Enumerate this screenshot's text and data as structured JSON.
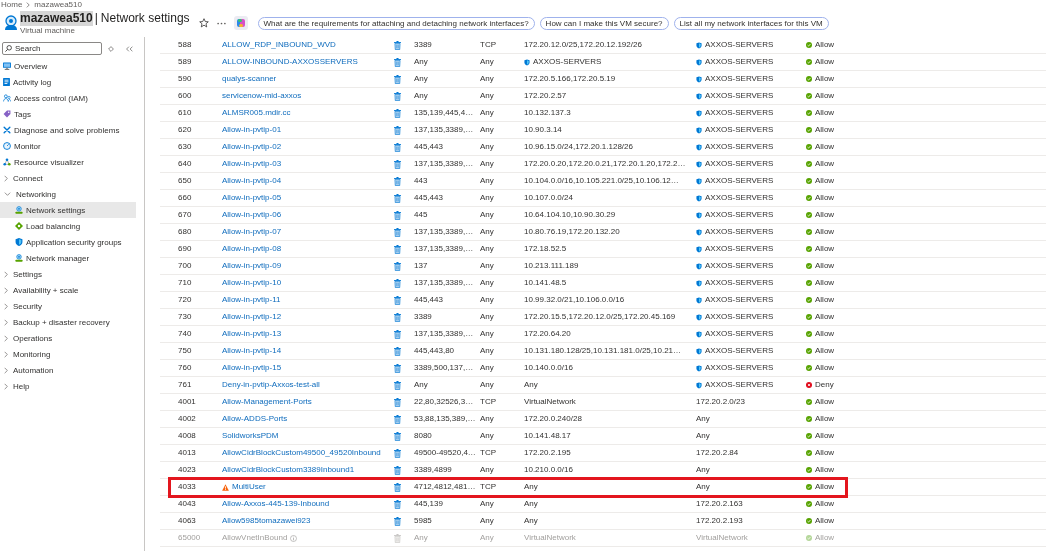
{
  "breadcrumb": [
    {
      "label": "Home"
    },
    {
      "label": "mazawea510"
    }
  ],
  "header": {
    "title": {
      "name": "mazawea510",
      "highlighted": true,
      "separator": "|",
      "page": "Network settings"
    },
    "subtitle": "Virtual machine",
    "suggestions": [
      {
        "label": "What are the requirements for attaching and detaching network interfaces?"
      },
      {
        "label": "How can I make this VM secure?"
      },
      {
        "label": "List all my network interfaces for this VM"
      }
    ]
  },
  "sidebar": {
    "search": {
      "placeholder": "Search"
    },
    "items": [
      {
        "kind": "link",
        "label": "Overview",
        "selected": false
      },
      {
        "kind": "link",
        "label": "Activity log",
        "selected": false
      },
      {
        "kind": "link",
        "label": "Access control (IAM)",
        "selected": false
      },
      {
        "kind": "link",
        "label": "Tags",
        "selected": false
      },
      {
        "kind": "link",
        "label": "Diagnose and solve problems",
        "selected": false
      },
      {
        "kind": "link",
        "label": "Monitor",
        "selected": false
      },
      {
        "kind": "link",
        "label": "Resource visualizer",
        "selected": false
      },
      {
        "kind": "group",
        "label": "Connect",
        "selected": false,
        "expanded": false
      },
      {
        "kind": "group",
        "label": "Networking",
        "selected": false,
        "expanded": true,
        "children": [
          {
            "kind": "link",
            "label": "Network settings",
            "selected": true
          },
          {
            "kind": "link",
            "label": "Load balancing",
            "selected": false
          },
          {
            "kind": "link",
            "label": "Application security groups",
            "selected": false
          },
          {
            "kind": "link",
            "label": "Network manager",
            "selected": false
          }
        ]
      },
      {
        "kind": "group",
        "label": "Settings",
        "selected": false,
        "expanded": false
      },
      {
        "kind": "group",
        "label": "Availability + scale",
        "selected": false,
        "expanded": false
      },
      {
        "kind": "group",
        "label": "Security",
        "selected": false,
        "expanded": false
      },
      {
        "kind": "group",
        "label": "Backup + disaster recovery",
        "selected": false,
        "expanded": false
      },
      {
        "kind": "group",
        "label": "Operations",
        "selected": false,
        "expanded": false
      },
      {
        "kind": "group",
        "label": "Monitoring",
        "selected": false,
        "expanded": false
      },
      {
        "kind": "group",
        "label": "Automation",
        "selected": false,
        "expanded": false
      },
      {
        "kind": "group",
        "label": "Help",
        "selected": false,
        "expanded": false
      }
    ]
  },
  "table": {
    "rows": [
      {
        "kind": "custom",
        "highlighted": false,
        "column_1": "588",
        "column_2": "ALLOW_RDP_INBOUND_WVD",
        "column_3": "3389",
        "column_4": "TCP",
        "column_5": {
          "kind": "address",
          "text": "172.20.12.0/25,172.20.12.192/26"
        },
        "column_6": {
          "kind": "group",
          "text": "AXXOS-SERVERS"
        },
        "column_7": {
          "kind": "allow",
          "text": "Allow"
        }
      },
      {
        "kind": "custom",
        "highlighted": false,
        "column_1": "589",
        "column_2": "ALLOW-INBOUND-AXXOSSERVERS",
        "column_3": "Any",
        "column_4": "Any",
        "column_5": {
          "kind": "group",
          "text": "AXXOS-SERVERS"
        },
        "column_6": {
          "kind": "group",
          "text": "AXXOS-SERVERS"
        },
        "column_7": {
          "kind": "allow",
          "text": "Allow"
        }
      },
      {
        "kind": "custom",
        "highlighted": false,
        "column_1": "590",
        "column_2": "qualys-scanner",
        "column_3": "Any",
        "column_4": "Any",
        "column_5": {
          "kind": "address",
          "text": "172.20.5.166,172.20.5.19"
        },
        "column_6": {
          "kind": "group",
          "text": "AXXOS-SERVERS"
        },
        "column_7": {
          "kind": "allow",
          "text": "Allow"
        }
      },
      {
        "kind": "custom",
        "highlighted": false,
        "column_1": "600",
        "column_2": "servicenow-mid-axxos",
        "column_3": "Any",
        "column_4": "Any",
        "column_5": {
          "kind": "address",
          "text": "172.20.2.57"
        },
        "column_6": {
          "kind": "group",
          "text": "AXXOS-SERVERS"
        },
        "column_7": {
          "kind": "allow",
          "text": "Allow"
        }
      },
      {
        "kind": "custom",
        "highlighted": false,
        "column_1": "610",
        "column_2": "ALMSR005.mdir.cc",
        "column_3": "135,139,445,4…",
        "column_4": "Any",
        "column_5": {
          "kind": "address",
          "text": "10.132.137.3"
        },
        "column_6": {
          "kind": "group",
          "text": "AXXOS-SERVERS"
        },
        "column_7": {
          "kind": "allow",
          "text": "Allow"
        }
      },
      {
        "kind": "custom",
        "highlighted": false,
        "column_1": "620",
        "column_2": "Allow-in-pvtip-01",
        "column_3": "137,135,3389,…",
        "column_4": "Any",
        "column_5": {
          "kind": "address",
          "text": "10.90.3.14"
        },
        "column_6": {
          "kind": "group",
          "text": "AXXOS-SERVERS"
        },
        "column_7": {
          "kind": "allow",
          "text": "Allow"
        }
      },
      {
        "kind": "custom",
        "highlighted": false,
        "column_1": "630",
        "column_2": "Allow-in-pvtip-02",
        "column_3": "445,443",
        "column_4": "Any",
        "column_5": {
          "kind": "address",
          "text": "10.96.15.0/24,172.20.1.128/26"
        },
        "column_6": {
          "kind": "group",
          "text": "AXXOS-SERVERS"
        },
        "column_7": {
          "kind": "allow",
          "text": "Allow"
        }
      },
      {
        "kind": "custom",
        "highlighted": false,
        "column_1": "640",
        "column_2": "Allow-in-pvtip-03",
        "column_3": "137,135,3389,…",
        "column_4": "Any",
        "column_5": {
          "kind": "address",
          "text": "172.20.0.20,172.20.0.21,172.20.1.20,172.2…"
        },
        "column_6": {
          "kind": "group",
          "text": "AXXOS-SERVERS"
        },
        "column_7": {
          "kind": "allow",
          "text": "Allow"
        }
      },
      {
        "kind": "custom",
        "highlighted": false,
        "column_1": "650",
        "column_2": "Allow-in-pvtip-04",
        "column_3": "443",
        "column_4": "Any",
        "column_5": {
          "kind": "address",
          "text": "10.104.0.0/16,10.105.221.0/25,10.106.12…"
        },
        "column_6": {
          "kind": "group",
          "text": "AXXOS-SERVERS"
        },
        "column_7": {
          "kind": "allow",
          "text": "Allow"
        }
      },
      {
        "kind": "custom",
        "highlighted": false,
        "column_1": "660",
        "column_2": "Allow-in-pvtip-05",
        "column_3": "445,443",
        "column_4": "Any",
        "column_5": {
          "kind": "address",
          "text": "10.107.0.0/24"
        },
        "column_6": {
          "kind": "group",
          "text": "AXXOS-SERVERS"
        },
        "column_7": {
          "kind": "allow",
          "text": "Allow"
        }
      },
      {
        "kind": "custom",
        "highlighted": false,
        "column_1": "670",
        "column_2": "Allow-in-pvtip-06",
        "column_3": "445",
        "column_4": "Any",
        "column_5": {
          "kind": "address",
          "text": "10.64.104.10,10.90.30.29"
        },
        "column_6": {
          "kind": "group",
          "text": "AXXOS-SERVERS"
        },
        "column_7": {
          "kind": "allow",
          "text": "Allow"
        }
      },
      {
        "kind": "custom",
        "highlighted": false,
        "column_1": "680",
        "column_2": "Allow-in-pvtip-07",
        "column_3": "137,135,3389,…",
        "column_4": "Any",
        "column_5": {
          "kind": "address",
          "text": "10.80.76.19,172.20.132.20"
        },
        "column_6": {
          "kind": "group",
          "text": "AXXOS-SERVERS"
        },
        "column_7": {
          "kind": "allow",
          "text": "Allow"
        }
      },
      {
        "kind": "custom",
        "highlighted": false,
        "column_1": "690",
        "column_2": "Allow-in-pvtip-08",
        "column_3": "137,135,3389,…",
        "column_4": "Any",
        "column_5": {
          "kind": "address",
          "text": "172.18.52.5"
        },
        "column_6": {
          "kind": "group",
          "text": "AXXOS-SERVERS"
        },
        "column_7": {
          "kind": "allow",
          "text": "Allow"
        }
      },
      {
        "kind": "custom",
        "highlighted": false,
        "column_1": "700",
        "column_2": "Allow-in-pvtip-09",
        "column_3": "137",
        "column_4": "Any",
        "column_5": {
          "kind": "address",
          "text": "10.213.111.189"
        },
        "column_6": {
          "kind": "group",
          "text": "AXXOS-SERVERS"
        },
        "column_7": {
          "kind": "allow",
          "text": "Allow"
        }
      },
      {
        "kind": "custom",
        "highlighted": false,
        "column_1": "710",
        "column_2": "Allow-in-pvtip-10",
        "column_3": "137,135,3389,…",
        "column_4": "Any",
        "column_5": {
          "kind": "address",
          "text": "10.141.48.5"
        },
        "column_6": {
          "kind": "group",
          "text": "AXXOS-SERVERS"
        },
        "column_7": {
          "kind": "allow",
          "text": "Allow"
        }
      },
      {
        "kind": "custom",
        "highlighted": false,
        "column_1": "720",
        "column_2": "Allow-in-pvtip-11",
        "column_3": "445,443",
        "column_4": "Any",
        "column_5": {
          "kind": "address",
          "text": "10.99.32.0/21,10.106.0.0/16"
        },
        "column_6": {
          "kind": "group",
          "text": "AXXOS-SERVERS"
        },
        "column_7": {
          "kind": "allow",
          "text": "Allow"
        }
      },
      {
        "kind": "custom",
        "highlighted": false,
        "column_1": "730",
        "column_2": "Allow-in-pvtip-12",
        "column_3": "3389",
        "column_4": "Any",
        "column_5": {
          "kind": "address",
          "text": "172.20.15.5,172.20.12.0/25,172.20.45.169"
        },
        "column_6": {
          "kind": "group",
          "text": "AXXOS-SERVERS"
        },
        "column_7": {
          "kind": "allow",
          "text": "Allow"
        }
      },
      {
        "kind": "custom",
        "highlighted": false,
        "column_1": "740",
        "column_2": "Allow-in-pvtip-13",
        "column_3": "137,135,3389,…",
        "column_4": "Any",
        "column_5": {
          "kind": "address",
          "text": "172.20.64.20"
        },
        "column_6": {
          "kind": "group",
          "text": "AXXOS-SERVERS"
        },
        "column_7": {
          "kind": "allow",
          "text": "Allow"
        }
      },
      {
        "kind": "custom",
        "highlighted": false,
        "column_1": "750",
        "column_2": "Allow-in-pvtip-14",
        "column_3": "445,443,80",
        "column_4": "Any",
        "column_5": {
          "kind": "address",
          "text": "10.131.180.128/25,10.131.181.0/25,10.21…"
        },
        "column_6": {
          "kind": "group",
          "text": "AXXOS-SERVERS"
        },
        "column_7": {
          "kind": "allow",
          "text": "Allow"
        }
      },
      {
        "kind": "custom",
        "highlighted": false,
        "column_1": "760",
        "column_2": "Allow-in-pvtip-15",
        "column_3": "3389,500,137,…",
        "column_4": "Any",
        "column_5": {
          "kind": "address",
          "text": "10.140.0.0/16"
        },
        "column_6": {
          "kind": "group",
          "text": "AXXOS-SERVERS"
        },
        "column_7": {
          "kind": "allow",
          "text": "Allow"
        }
      },
      {
        "kind": "custom",
        "highlighted": false,
        "column_1": "761",
        "column_2": "Deny-in-pvtip-Axxos-test-all",
        "column_3": "Any",
        "column_4": "Any",
        "column_5": {
          "kind": "address",
          "text": "Any"
        },
        "column_6": {
          "kind": "group",
          "text": "AXXOS-SERVERS"
        },
        "column_7": {
          "kind": "deny",
          "text": "Deny"
        }
      },
      {
        "kind": "custom",
        "highlighted": false,
        "column_1": "4001",
        "column_2": "Allow-Management-Ports",
        "column_3": "22,80,32526,3…",
        "column_4": "TCP",
        "column_5": {
          "kind": "address",
          "text": "VirtualNetwork"
        },
        "column_6": {
          "kind": "address",
          "text": "172.20.2.0/23"
        },
        "column_7": {
          "kind": "allow",
          "text": "Allow"
        }
      },
      {
        "kind": "custom",
        "highlighted": false,
        "column_1": "4002",
        "column_2": "Allow-ADDS-Ports",
        "column_3": "53,88,135,389,…",
        "column_4": "Any",
        "column_5": {
          "kind": "address",
          "text": "172.20.0.240/28"
        },
        "column_6": {
          "kind": "address",
          "text": "Any"
        },
        "column_7": {
          "kind": "allow",
          "text": "Allow"
        }
      },
      {
        "kind": "custom",
        "highlighted": false,
        "column_1": "4008",
        "column_2": "SolidworksPDM",
        "column_3": "8080",
        "column_4": "Any",
        "column_5": {
          "kind": "address",
          "text": "10.141.48.17"
        },
        "column_6": {
          "kind": "address",
          "text": "Any"
        },
        "column_7": {
          "kind": "allow",
          "text": "Allow"
        }
      },
      {
        "kind": "custom",
        "highlighted": false,
        "column_1": "4013",
        "column_2": "AllowCidrBlockCustom49500_49520Inbound",
        "column_3": "49500-49520,4…",
        "column_4": "TCP",
        "column_5": {
          "kind": "address",
          "text": "172.20.2.195"
        },
        "column_6": {
          "kind": "address",
          "text": "172.20.2.84"
        },
        "column_7": {
          "kind": "allow",
          "text": "Allow"
        }
      },
      {
        "kind": "custom",
        "highlighted": false,
        "column_1": "4023",
        "column_2": "AllowCidrBlockCustom3389Inbound1",
        "column_3": "3389,4899",
        "column_4": "Any",
        "column_5": {
          "kind": "address",
          "text": "10.210.0.0/16"
        },
        "column_6": {
          "kind": "address",
          "text": "Any"
        },
        "column_7": {
          "kind": "allow",
          "text": "Allow"
        }
      },
      {
        "kind": "warning",
        "highlighted": true,
        "column_1": "4033",
        "column_2": "MultiUser",
        "column_3": "4712,4812,481…",
        "column_4": "TCP",
        "column_5": {
          "kind": "address",
          "text": "Any"
        },
        "column_6": {
          "kind": "address",
          "text": "Any"
        },
        "column_7": {
          "kind": "allow",
          "text": "Allow"
        }
      },
      {
        "kind": "custom",
        "highlighted": false,
        "column_1": "4043",
        "column_2": "Allow-Axxos-445-139-Inbound",
        "column_3": "445,139",
        "column_4": "Any",
        "column_5": {
          "kind": "address",
          "text": "Any"
        },
        "column_6": {
          "kind": "address",
          "text": "172.20.2.163"
        },
        "column_7": {
          "kind": "allow",
          "text": "Allow"
        }
      },
      {
        "kind": "custom",
        "highlighted": false,
        "column_1": "4063",
        "column_2": "Allow5985tomazawei923",
        "column_3": "5985",
        "column_4": "Any",
        "column_5": {
          "kind": "address",
          "text": "Any"
        },
        "column_6": {
          "kind": "address",
          "text": "172.20.2.193"
        },
        "column_7": {
          "kind": "allow",
          "text": "Allow"
        }
      },
      {
        "kind": "default",
        "highlighted": false,
        "column_1": "65000",
        "column_2": "AllowVnetInBound",
        "column_3": "Any",
        "column_4": "Any",
        "column_5": {
          "kind": "address",
          "text": "VirtualNetwork"
        },
        "column_6": {
          "kind": "address",
          "text": "VirtualNetwork"
        },
        "column_7": {
          "kind": "allow",
          "text": "Allow"
        }
      }
    ]
  }
}
